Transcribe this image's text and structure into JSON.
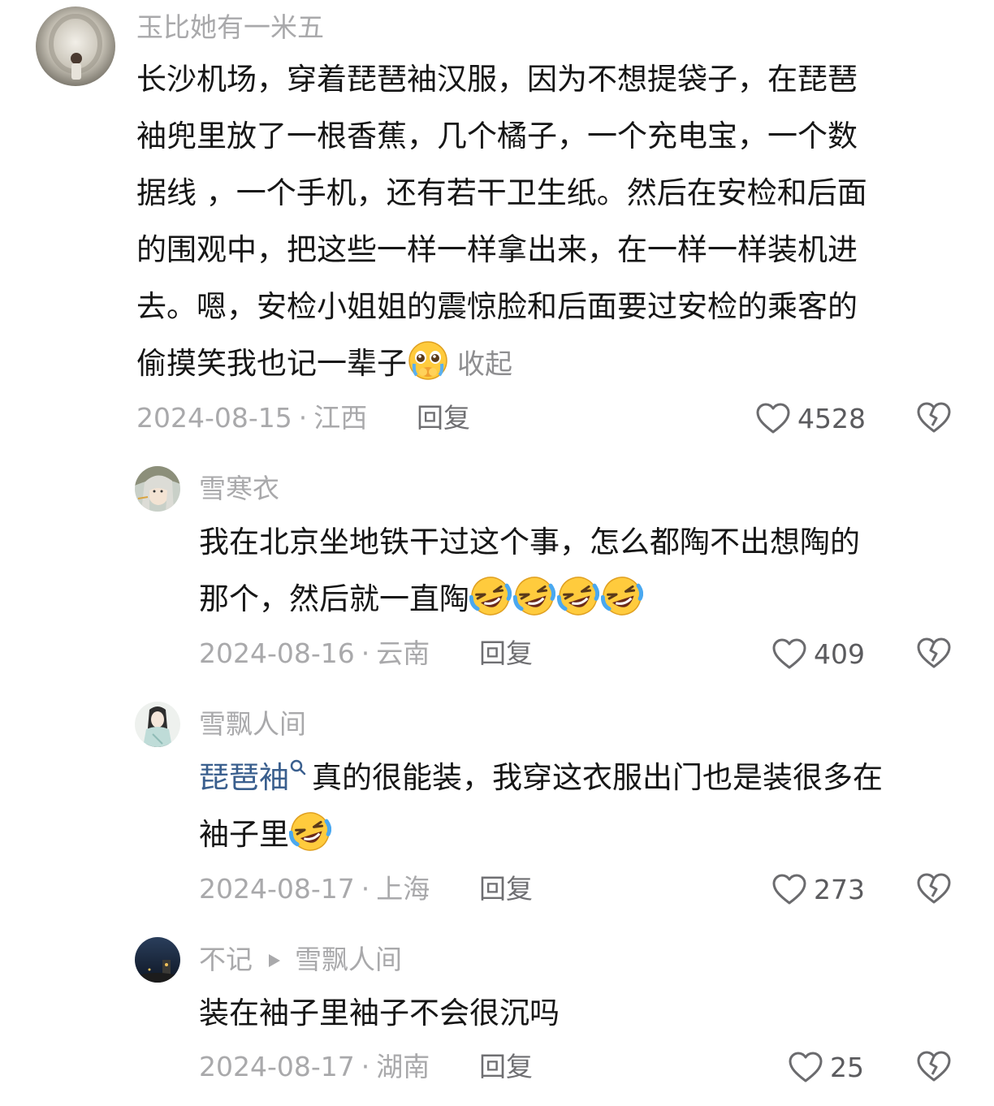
{
  "comments": [
    {
      "username": "玉比她有一米五",
      "lines": [
        "长沙机场，穿着琵琶袖汉服，因为不想提袋子，在琵琶",
        "袖兜里放了一根香蕉，几个橘子，一个充电宝，一个数",
        "据线 ，一个手机，还有若干卫生纸。然后在安检和后面",
        "的围观中，把这些一样一样拿出来，在一样一样装机进",
        "去。嗯，安检小姐姐的震惊脸和后面要过安检的乘客的",
        "偷摸笑我也记一辈子"
      ],
      "collapse_label": "收起",
      "date": "2024-08-15",
      "location": "江西",
      "reply_label": "回复",
      "likes": "4528"
    },
    {
      "username": "雪寒衣",
      "lines": [
        "我在北京坐地铁干过这个事，怎么都陶不出想陶的",
        "那个，然后就一直陶"
      ],
      "date": "2024-08-16",
      "location": "云南",
      "reply_label": "回复",
      "likes": "409"
    },
    {
      "username": "雪飘人间",
      "topic": "琵琶袖",
      "lines": [
        "真的很能装，我穿这衣服出门也是装很多在",
        "袖子里"
      ],
      "date": "2024-08-17",
      "location": "上海",
      "reply_label": "回复",
      "likes": "273"
    },
    {
      "username": "不记",
      "reply_to": "雪飘人间",
      "lines": [
        "装在袖子里袖子不会很沉吗"
      ],
      "date": "2024-08-17",
      "location": "湖南",
      "reply_label": "回复",
      "likes": "25"
    }
  ],
  "separator_dot": "·",
  "icons": {
    "like": "heart-outline-icon",
    "dislike": "broken-heart-icon",
    "pleading_emoji": "pleading-face-emoji",
    "laughing_emoji": "rofl-crying-emoji"
  },
  "colors": {
    "text": "#161616",
    "muted": "#a9a9ab",
    "topic_link": "#3a5f8e"
  }
}
